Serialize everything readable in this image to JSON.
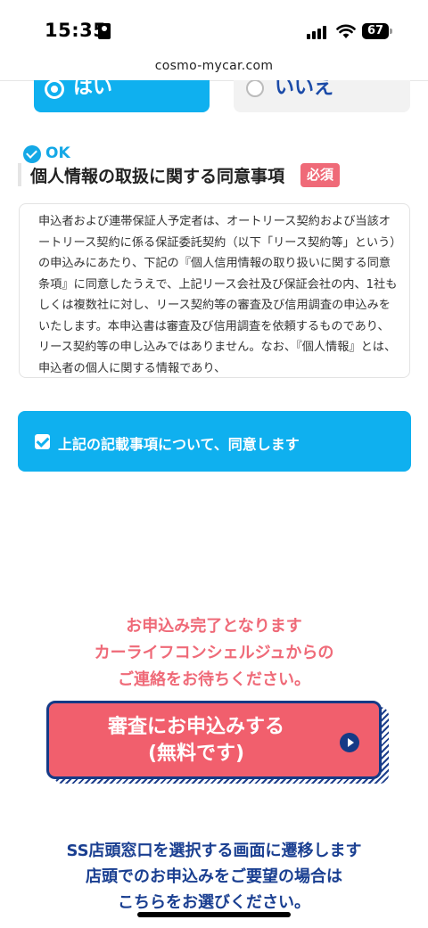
{
  "status_bar": {
    "time": "15:35",
    "battery": "67",
    "icons": [
      "id-card-icon",
      "signal-icon",
      "wifi-icon",
      "battery-icon"
    ]
  },
  "browser": {
    "url": "cosmo-mycar.com"
  },
  "choice": {
    "yes_label": "はい",
    "no_label": "いいえ",
    "selected": "yes"
  },
  "consent_section": {
    "ok_label": "OK",
    "title": "個人情報の取扱に関する同意事項",
    "required_badge": "必須",
    "body": "申込者および連帯保証人予定者は、オートリース契約および当該オートリース契約に係る保証委託契約（以下「リース契約等」という）の申込みにあたり、下記の『個人信用情報の取り扱いに関する同意条項』に同意したうえで、上記リース会社及び保証会社の内、1社もしくは複数社に対し、リース契約等の審査及び信用調査の申込みをいたします。本申込書は審査及び信用調査を依頼するものであり、リース契約等の申し込みではありません。なお、『個人情報』とは、申込者の個人に関する情報であり、"
  },
  "agree": {
    "label": "上記の記載事項について、同意します",
    "checked": true
  },
  "notice": {
    "line1": "お申込み完了となります",
    "line2": "カーライフコンシェルジュからの",
    "line3": "ご連絡をお待ちください。"
  },
  "submit": {
    "line1": "審査にお申込みする",
    "line2": "(無料です)"
  },
  "store_link": {
    "line1": "SS店頭窓口を選択する画面に遷移します",
    "line2": "店頭でのお申込みをご要望の場合は",
    "line3": "こちらをお選びください。"
  },
  "colors": {
    "accent_blue": "#0fb0ef",
    "submit_red": "#f15f6d",
    "navy": "#153a86",
    "required_red": "#ef6a78"
  }
}
